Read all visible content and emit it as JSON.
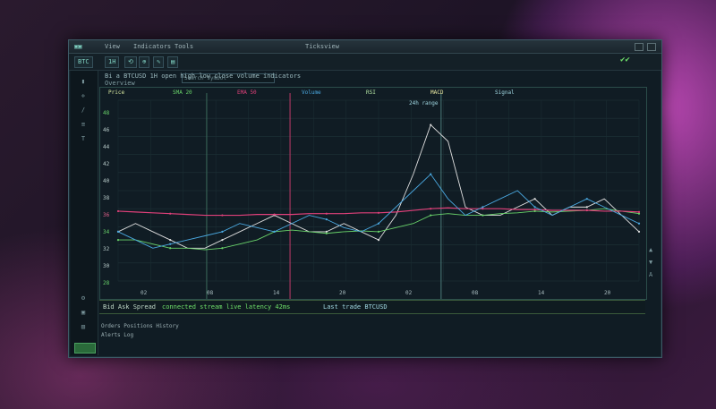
{
  "window": {
    "title": "Ticksview",
    "menu": [
      "View",
      "Indicators",
      "Tools"
    ],
    "accent_green": "#6fe06a",
    "accent_pink": "#e0407a",
    "accent_blue": "#4aa8e0"
  },
  "toolbar": {
    "symbol_value": "BTC",
    "timeframe": "1H",
    "buttons": [
      "⟲",
      "⊕",
      "✎",
      "▤"
    ],
    "search_placeholder": "Search symbol",
    "status_icon": "ok-icon"
  },
  "info": {
    "line1": "Bi a BTCUSD  1H  open high low close volume indicators",
    "line2": "Overview"
  },
  "legend": {
    "items": [
      "Price",
      "SMA 20",
      "EMA 50",
      "Volume",
      "RSI",
      "MACD",
      "Signal"
    ],
    "range_label": "24h range"
  },
  "y_labels": [
    {
      "text": "48",
      "tone": "g"
    },
    {
      "text": "46",
      "tone": ""
    },
    {
      "text": "44",
      "tone": ""
    },
    {
      "text": "42",
      "tone": ""
    },
    {
      "text": "40",
      "tone": ""
    },
    {
      "text": "38",
      "tone": ""
    },
    {
      "text": "36",
      "tone": "r"
    },
    {
      "text": "34",
      "tone": "g"
    },
    {
      "text": "32",
      "tone": ""
    },
    {
      "text": "30",
      "tone": ""
    },
    {
      "text": "28",
      "tone": "g"
    }
  ],
  "x_ticks": [
    "02",
    "08",
    "14",
    "20",
    "02",
    "08",
    "14",
    "20"
  ],
  "statusbar": {
    "left": "Bid  Ask  Spread",
    "middle": "connected  stream live  latency 42ms",
    "right": "Last trade  BTCUSD"
  },
  "bottom": {
    "line1": "Orders  Positions  History",
    "line2": "Alerts  Log"
  },
  "chart_data": {
    "type": "line",
    "x": [
      0,
      1,
      2,
      3,
      4,
      5,
      6,
      7,
      8,
      9,
      10,
      11,
      12,
      13,
      14,
      15,
      16,
      17,
      18,
      19,
      20,
      21,
      22,
      23,
      24,
      25,
      26,
      27,
      28,
      29,
      30
    ],
    "series": [
      {
        "name": "Price",
        "color": "#e0e0e0",
        "values": [
          33,
          34,
          33,
          32,
          31,
          31,
          32,
          33,
          34,
          35,
          34,
          33,
          33,
          34,
          33,
          32,
          35,
          40,
          46,
          44,
          36,
          35,
          35,
          36,
          37,
          35,
          36,
          36,
          37,
          35,
          33
        ]
      },
      {
        "name": "SMA 20",
        "color": "#69d36a",
        "values": [
          32,
          32,
          31.5,
          31,
          31,
          30.8,
          31,
          31.5,
          32,
          33,
          33.2,
          33,
          32.8,
          33,
          33.1,
          33,
          33.5,
          34,
          35,
          35.2,
          35,
          35,
          35.2,
          35.3,
          35.5,
          35.4,
          35.5,
          35.6,
          35.8,
          35.5,
          35.2
        ]
      },
      {
        "name": "EMA 50",
        "color": "#e0407a",
        "values": [
          35.5,
          35.4,
          35.3,
          35.2,
          35.1,
          35.0,
          35.0,
          35.0,
          35.1,
          35.1,
          35.1,
          35.2,
          35.2,
          35.2,
          35.3,
          35.3,
          35.4,
          35.6,
          35.8,
          35.9,
          35.8,
          35.8,
          35.8,
          35.7,
          35.7,
          35.6,
          35.6,
          35.6,
          35.5,
          35.5,
          35.4
        ]
      },
      {
        "name": "Volume",
        "color": "#4aa8e0",
        "values": [
          33,
          32,
          31,
          31.5,
          32,
          32.5,
          33,
          34,
          33.5,
          33,
          34,
          35,
          34.5,
          33.5,
          33,
          34,
          36,
          38,
          40,
          37,
          35,
          36,
          37,
          38,
          36,
          35,
          36,
          37,
          36,
          35,
          34
        ]
      }
    ],
    "ylim": [
      27,
      49
    ],
    "grid": true,
    "legend": "top-left"
  }
}
